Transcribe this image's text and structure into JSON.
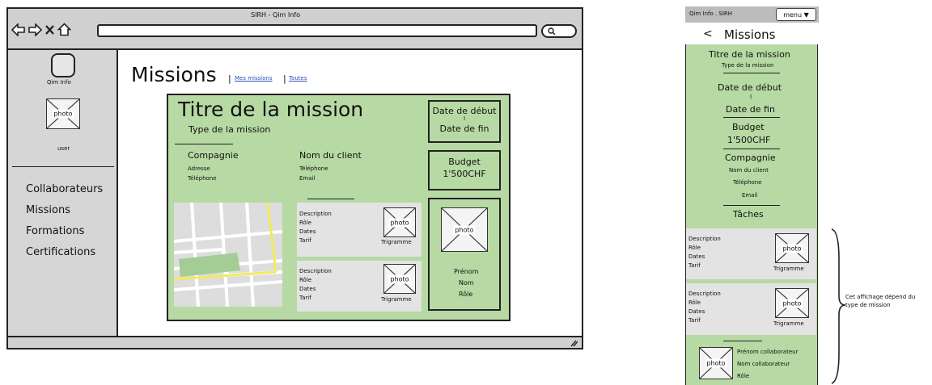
{
  "window": {
    "title": "SIRH - Qim Info"
  },
  "sidebar": {
    "logo_label": "Qim Info",
    "user_photo_label": "photo",
    "user_label": "user",
    "items": [
      {
        "label": "Collaborateurs"
      },
      {
        "label": "Missions"
      },
      {
        "label": "Formations"
      },
      {
        "label": "Certifications"
      }
    ]
  },
  "page": {
    "title": "Missions",
    "link_mine": "Mes missions",
    "link_all": "Toutes"
  },
  "mission": {
    "title": "Titre de la mission",
    "type": "Type de la mission",
    "date_start": "Date de début",
    "date_sep": "I",
    "date_end": "Date de fin",
    "budget_label": "Budget",
    "budget_value": "1'500CHF",
    "company": {
      "name": "Compagnie",
      "address": "Adresse",
      "phone": "Téléphone"
    },
    "client": {
      "name": "Nom du client",
      "phone": "Téléphone",
      "email": "Email"
    },
    "tasks": [
      {
        "description": "Description",
        "role": "Rôle",
        "dates": "Dates",
        "rate": "Tarif",
        "photo": "photo",
        "trigram": "Trigramme"
      },
      {
        "description": "Description",
        "role": "Rôle",
        "dates": "Dates",
        "rate": "Tarif",
        "photo": "photo",
        "trigram": "Trigramme"
      }
    ],
    "person": {
      "photo": "photo",
      "first_name": "Prénom",
      "last_name": "Nom",
      "role": "Rôle"
    }
  },
  "mobile": {
    "app_title": "Qim Info . SIRH",
    "menu_label": "menu ▼",
    "back_label": "<",
    "page_title": "Missions",
    "mission_title": "Titre de la mission",
    "mission_type": "Type de la mission",
    "date_start": "Date de début",
    "date_sep": "I",
    "date_end": "Date de fin",
    "budget_label": "Budget",
    "budget_value": "1'500CHF",
    "company": "Compagnie",
    "client_name": "Nom du client",
    "client_phone": "Téléphone",
    "client_email": "Email",
    "tasks_title": "Tâches",
    "tasks": [
      {
        "description": "Description",
        "role": "Rôle",
        "dates": "Dates",
        "rate": "Tarif",
        "photo": "photo",
        "trigram": "Trigramme"
      },
      {
        "description": "Description",
        "role": "Rôle",
        "dates": "Dates",
        "rate": "Tarif",
        "photo": "photo",
        "trigram": "Trigramme"
      }
    ],
    "collaborator": {
      "photo": "photo",
      "first_name": "Prénom collaborateur",
      "last_name": "Nom collaborateur",
      "role": "Rôle"
    }
  },
  "annotation": {
    "line1": "Cet affichage dépend du",
    "line2": "type de mission"
  }
}
